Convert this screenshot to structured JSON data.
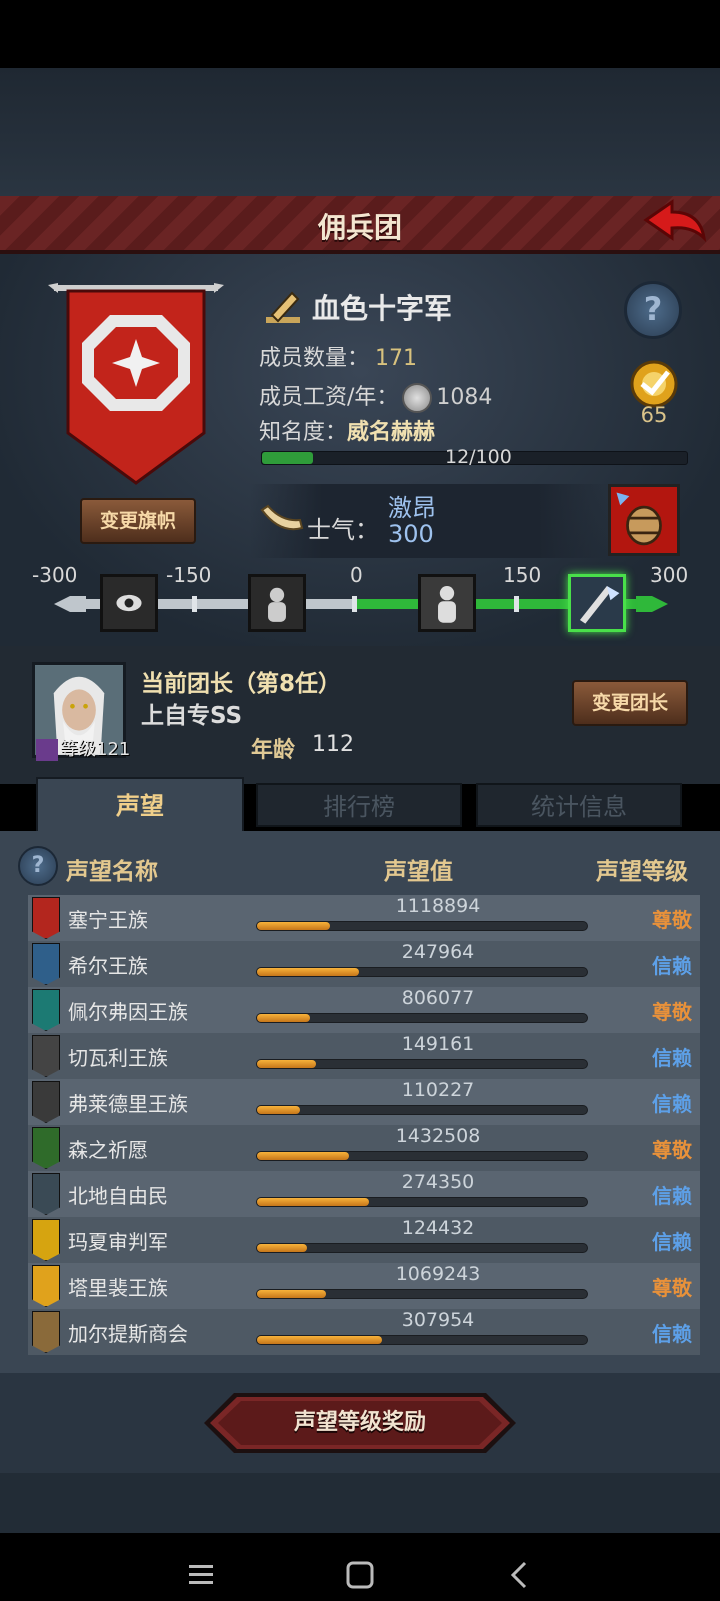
{
  "header": {
    "title": "佣兵团"
  },
  "guild": {
    "name": "血色十字军",
    "members_label": "成员数量：",
    "members_value": "171",
    "salary_label": "成员工资/年：",
    "salary_value": "1084",
    "fame_label": "知名度：",
    "fame_value": "威名赫赫",
    "fame_progress_text": "12/100",
    "fame_progress": 0.12,
    "level": "65",
    "change_flag_label": "变更旗帜"
  },
  "morale": {
    "label": "士气：",
    "state": "激昂",
    "value": "300",
    "scale_ticks": [
      "-300",
      "-150",
      "0",
      "150",
      "300"
    ]
  },
  "leader": {
    "title": "当前团长（第8任）",
    "name": "上自专SS",
    "level_label": "等级121",
    "age_label": "年龄",
    "age_value": "112",
    "change_leader_label": "变更团长"
  },
  "tabs": [
    {
      "label": "声望"
    },
    {
      "label": "排行榜"
    },
    {
      "label": "统计信息"
    }
  ],
  "reputation": {
    "col_name": "声望名称",
    "col_value": "声望值",
    "col_level": "声望等级",
    "rows": [
      {
        "name": "塞宁王族",
        "value": "1118894",
        "level": "尊敬",
        "fill": 0.22
      },
      {
        "name": "希尔王族",
        "value": "247964",
        "level": "信赖",
        "fill": 0.31
      },
      {
        "name": "佩尔弗因王族",
        "value": "806077",
        "level": "尊敬",
        "fill": 0.16
      },
      {
        "name": "切瓦利王族",
        "value": "149161",
        "level": "信赖",
        "fill": 0.18
      },
      {
        "name": "弗莱德里王族",
        "value": "110227",
        "level": "信赖",
        "fill": 0.13
      },
      {
        "name": "森之祈愿",
        "value": "1432508",
        "level": "尊敬",
        "fill": 0.28
      },
      {
        "name": "北地自由民",
        "value": "274350",
        "level": "信赖",
        "fill": 0.34
      },
      {
        "name": "玛夏审判军",
        "value": "124432",
        "level": "信赖",
        "fill": 0.15
      },
      {
        "name": "塔里裴王族",
        "value": "1069243",
        "level": "尊敬",
        "fill": 0.21
      },
      {
        "name": "加尔提斯商会",
        "value": "307954",
        "level": "信赖",
        "fill": 0.38
      }
    ]
  },
  "reward_button_label": "声望等级奖励",
  "colors": {
    "respect": "#e8913a",
    "trust": "#5da0e8",
    "morale_green": "#2fb83a"
  }
}
